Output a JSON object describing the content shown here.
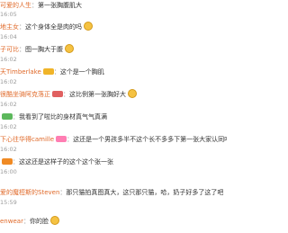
{
  "comments": [
    {
      "name": "可爱的人生",
      "text": "第一张胸腹肌大",
      "time": "16:05"
    },
    {
      "name": "地主女",
      "text": "这个身体全是肉的吗",
      "time": "16:04"
    },
    {
      "name": "子可比",
      "text": "图一胸大于腹",
      "time": "16:02"
    },
    {
      "name": "天Timberlake",
      "text": "这个是一个胸肌",
      "time": "16:02"
    },
    {
      "name": "很酷坐骑阿克落正",
      "text": "这比例第一张胸好大",
      "time": "16:02"
    },
    {
      "name": "",
      "text": "我看到了啦比的身材真气气真满",
      "time": "16:02"
    },
    {
      "name": "下心往华得camille",
      "text": "这还是一个男孩多半不这个长不多多下第一张大家认同吧",
      "time": "16:02"
    },
    {
      "name": "",
      "text": "这这还是这样子的这个这个张一张",
      "time": "16:00"
    },
    {
      "name": "爱的魔梪斯的Steven",
      "text": "那只猫拍真图真大，这只那只猫，哈，奶子好多了这了吧",
      "time": "15:59"
    },
    {
      "name": "enwear",
      "text": "你的脸",
      "time": ""
    }
  ],
  "ui": {
    "name_color": "#e06a2a",
    "text_color": "#333333",
    "time_color": "#9a9a9a"
  }
}
